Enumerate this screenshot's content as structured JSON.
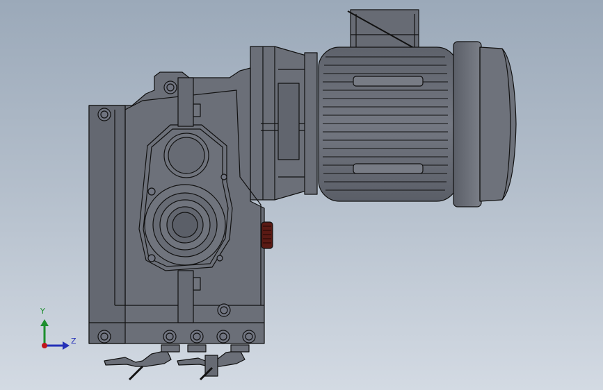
{
  "viewport": {
    "background_top": "#9ba9b9",
    "background_bottom": "#d3dae3"
  },
  "model": {
    "description_icon": "gearmotor-assembly",
    "body_color": "#6b6f78",
    "edge_color": "#111111",
    "knob_color": "#5a1a14"
  },
  "triad": {
    "y_label": "Y",
    "z_label": "Z",
    "y_color": "#1d8f2e",
    "z_color": "#2430b8",
    "origin_color": "#c0161b"
  }
}
